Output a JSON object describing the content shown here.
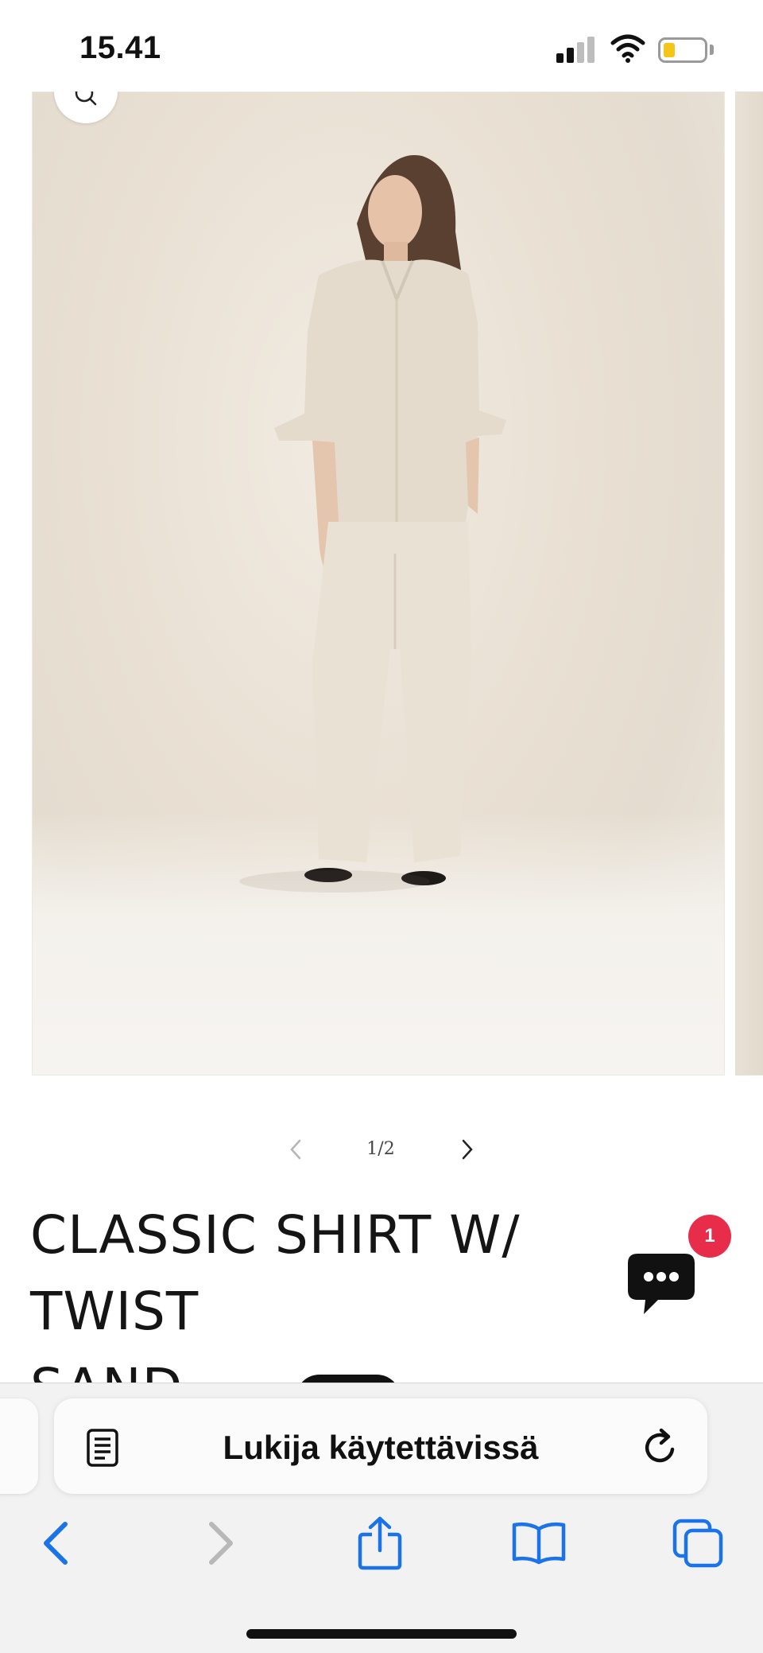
{
  "status_bar": {
    "time": "15.41",
    "signal_icon": "cellular-signal-icon",
    "wifi_icon": "wifi-icon",
    "battery_icon": "battery-icon",
    "battery_level_color": "#f5c518"
  },
  "gallery": {
    "zoom_icon": "search-icon",
    "image_description_icon": "product-photo",
    "pagination": {
      "prev_icon": "chevron-left-icon",
      "counter": "1/2",
      "next_icon": "chevron-right-icon"
    }
  },
  "product": {
    "title_line1": "CLASSIC SHIRT W/ TWIST",
    "title_line2": "SAND"
  },
  "chat": {
    "icon": "chat-bubble-icon",
    "badge_count": "1",
    "badge_color": "#e82d4a"
  },
  "browser": {
    "reader_icon": "reader-mode-icon",
    "address_label": "Lukija käytettävissä",
    "reload_icon": "reload-icon",
    "accent_color": "#1a73e8",
    "toolbar": {
      "back_icon": "back-arrow-icon",
      "forward_icon": "forward-arrow-icon",
      "share_icon": "share-icon",
      "bookmarks_icon": "bookmarks-icon",
      "tabs_icon": "tabs-icon"
    }
  }
}
